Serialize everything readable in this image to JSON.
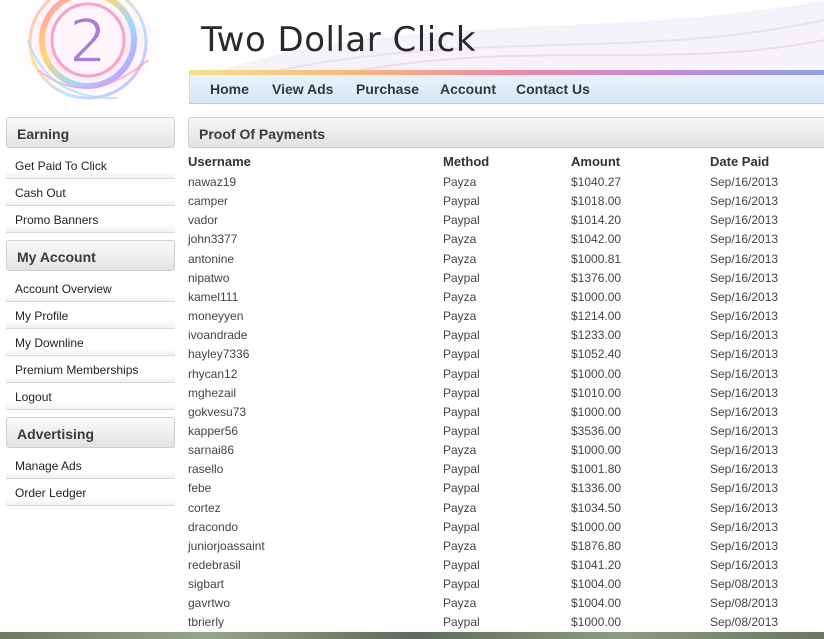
{
  "site": {
    "title": "Two Dollar Click",
    "logo_digit": "2"
  },
  "nav": {
    "items": [
      {
        "label": "Home"
      },
      {
        "label": "View Ads"
      },
      {
        "label": "Purchase"
      },
      {
        "label": "Account"
      },
      {
        "label": "Contact Us"
      }
    ]
  },
  "sidebar": {
    "sections": [
      {
        "title": "Earning",
        "items": [
          "Get Paid To Click",
          "Cash Out",
          "Promo Banners"
        ]
      },
      {
        "title": "My Account",
        "items": [
          "Account Overview",
          "My Profile",
          "My Downline",
          "Premium Memberships",
          "Logout"
        ]
      },
      {
        "title": "Advertising",
        "items": [
          "Manage Ads",
          "Order Ledger"
        ]
      }
    ]
  },
  "main": {
    "title": "Proof Of Payments",
    "columns": [
      "Username",
      "Method",
      "Amount",
      "Date Paid"
    ],
    "rows": [
      [
        "nawaz19",
        "Payza",
        "$1040.27",
        "Sep/16/2013"
      ],
      [
        "camper",
        "Paypal",
        "$1018.00",
        "Sep/16/2013"
      ],
      [
        "vador",
        "Paypal",
        "$1014.20",
        "Sep/16/2013"
      ],
      [
        "john3377",
        "Payza",
        "$1042.00",
        "Sep/16/2013"
      ],
      [
        "antonine",
        "Payza",
        "$1000.81",
        "Sep/16/2013"
      ],
      [
        "nipatwo",
        "Paypal",
        "$1376.00",
        "Sep/16/2013"
      ],
      [
        "kamel111",
        "Payza",
        "$1000.00",
        "Sep/16/2013"
      ],
      [
        "moneyyen",
        "Payza",
        "$1214.00",
        "Sep/16/2013"
      ],
      [
        "ivoandrade",
        "Paypal",
        "$1233.00",
        "Sep/16/2013"
      ],
      [
        "hayley7336",
        "Paypal",
        "$1052.40",
        "Sep/16/2013"
      ],
      [
        "rhycan12",
        "Paypal",
        "$1000.00",
        "Sep/16/2013"
      ],
      [
        "mghezail",
        "Paypal",
        "$1010.00",
        "Sep/16/2013"
      ],
      [
        "gokvesu73",
        "Paypal",
        "$1000.00",
        "Sep/16/2013"
      ],
      [
        "kapper56",
        "Paypal",
        "$3536.00",
        "Sep/16/2013"
      ],
      [
        "sarnai86",
        "Payza",
        "$1000.00",
        "Sep/16/2013"
      ],
      [
        "rasello",
        "Paypal",
        "$1001.80",
        "Sep/16/2013"
      ],
      [
        "febe",
        "Paypal",
        "$1336.00",
        "Sep/16/2013"
      ],
      [
        "cortez",
        "Payza",
        "$1034.50",
        "Sep/16/2013"
      ],
      [
        "dracondo",
        "Paypal",
        "$1000.00",
        "Sep/16/2013"
      ],
      [
        "juniorjoassaint",
        "Payza",
        "$1876.80",
        "Sep/16/2013"
      ],
      [
        "redebrasil",
        "Paypal",
        "$1041.20",
        "Sep/16/2013"
      ],
      [
        "sigbart",
        "Paypal",
        "$1004.00",
        "Sep/08/2013"
      ],
      [
        "gavrtwo",
        "Payza",
        "$1004.00",
        "Sep/08/2013"
      ],
      [
        "tbrierly",
        "Paypal",
        "$1000.00",
        "Sep/08/2013"
      ]
    ]
  }
}
